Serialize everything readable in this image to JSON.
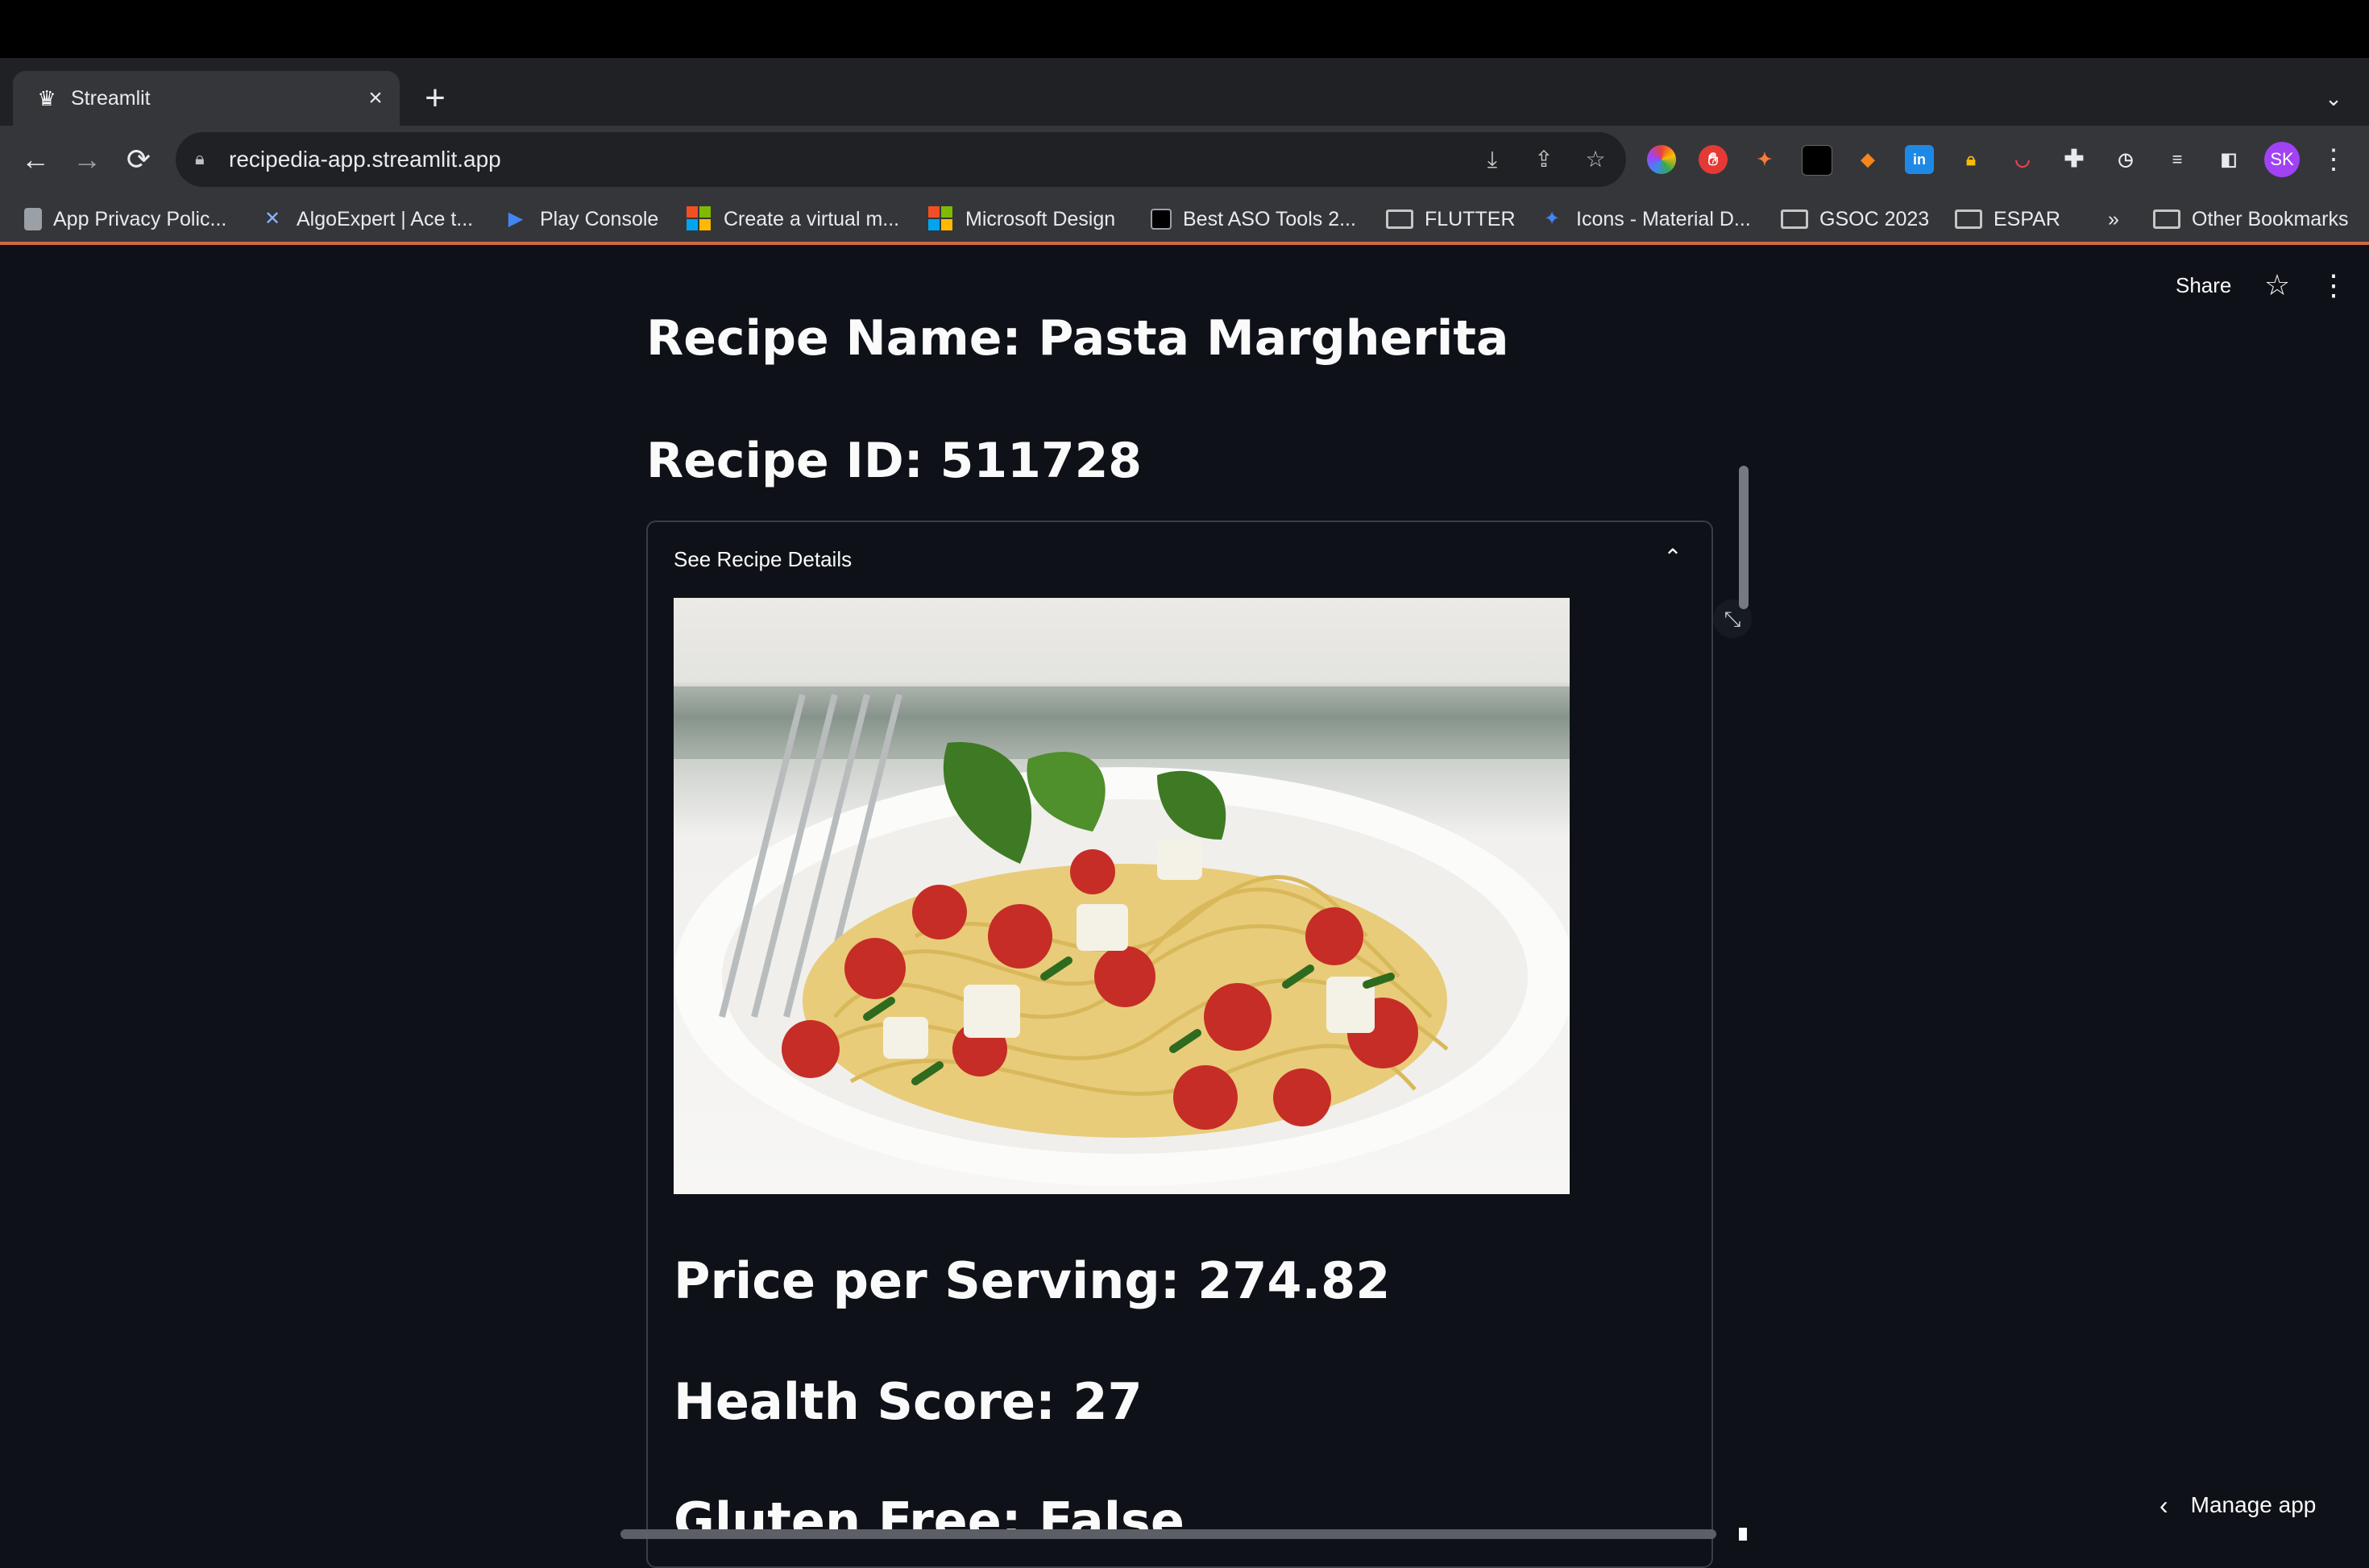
{
  "browser": {
    "tab": {
      "title": "Streamlit",
      "favicon": "crown-icon"
    },
    "nav": {
      "back": "←",
      "forward": "→",
      "reload": "⟳"
    },
    "omnibox": {
      "url": "recipedia-app.streamlit.app"
    },
    "profile": {
      "initials": "SK"
    }
  },
  "bookmarks": [
    {
      "label": "App Privacy Polic..."
    },
    {
      "label": "AlgoExpert | Ace t..."
    },
    {
      "label": "Play Console"
    },
    {
      "label": "Create a virtual m..."
    },
    {
      "label": "Microsoft Design"
    },
    {
      "label": "Best ASO Tools 2..."
    },
    {
      "label": "FLUTTER"
    },
    {
      "label": "Icons - Material D..."
    },
    {
      "label": "GSOC 2023"
    },
    {
      "label": "ESPAR"
    },
    {
      "label": "»"
    },
    {
      "label": "Other Bookmarks"
    }
  ],
  "app": {
    "share_label": "Share",
    "recipe_name": "Recipe Name: Pasta Margherita",
    "recipe_id": "Recipe ID: 511728",
    "expander_label": "See Recipe Details",
    "price": "Price per Serving: 274.82",
    "health": "Health Score: 27",
    "gluten": "Gluten Free: False",
    "manage_label": "Manage app"
  },
  "colors": {
    "app_bg": "#0e1117",
    "browser_frame": "#35363a",
    "profile_avatar": "#a142f4"
  }
}
